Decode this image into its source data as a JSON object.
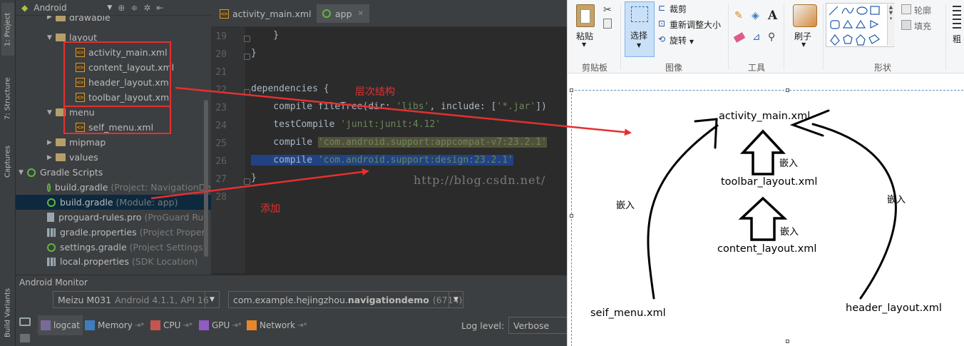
{
  "ide": {
    "tool_tabs": [
      "1: Project",
      "7: Structure",
      "Captures",
      "Build Variants"
    ],
    "project_view": "Android",
    "tree": {
      "drawable": "drawable",
      "layout": "layout",
      "layout_files": [
        "activity_main.xml",
        "content_layout.xml",
        "header_layout.xml",
        "toolbar_layout.xml"
      ],
      "menu": "menu",
      "menu_files": [
        "self_menu.xml"
      ],
      "mipmap": "mipmap",
      "values": "values",
      "gradle_scripts": "Gradle Scripts",
      "gradle_items": [
        {
          "name": "build.gradle",
          "sub": "(Project: NavigationDe"
        },
        {
          "name": "build.gradle",
          "sub": "(Module: app)"
        },
        {
          "name": "proguard-rules.pro",
          "sub": "(ProGuard Rul"
        },
        {
          "name": "gradle.properties",
          "sub": "(Project Propert"
        },
        {
          "name": "settings.gradle",
          "sub": "(Project Settings)"
        },
        {
          "name": "local.properties",
          "sub": "(SDK Location)"
        }
      ]
    },
    "editor_tabs": [
      "activity_main.xml",
      "app"
    ],
    "line_numbers": [
      "19",
      "20",
      "21",
      "22",
      "23",
      "24",
      "25",
      "26",
      "27",
      "28"
    ],
    "code": {
      "l19": "    }",
      "l20": "}",
      "l22": "dependencies {",
      "l23_a": "    compile fileTree(dir: ",
      "l23_s1": "'libs'",
      "l23_b": ", include: [",
      "l23_s2": "'*.jar'",
      "l23_c": "])",
      "l24_a": "    testCompile ",
      "l24_s": "'junit:junit:4.12'",
      "l25_a": "    compile ",
      "l25_s": "'com.android.support:appcompat-v7:23.2.1'",
      "l26_a": "    compile ",
      "l26_s": "'com.android.support:design:23.2.1'",
      "l27": "}"
    },
    "annotation_layers": "层次结构",
    "annotation_add": "添加",
    "watermark": "http://blog.csdn.net/",
    "monitor": {
      "title": "Android Monitor",
      "device": "Meizu M031",
      "device_sub": "Android 4.1.1, API 16",
      "process_prefix": "com.example.hejingzhou.",
      "process_bold": "navigationdemo",
      "process_pid": "(6714)",
      "tabs": [
        "logcat",
        "Memory",
        "CPU",
        "GPU",
        "Network"
      ],
      "log_level_label": "Log level:",
      "log_level_value": "Verbose"
    }
  },
  "paint": {
    "ribbon": {
      "clipboard_label": "剪贴板",
      "paste": "粘贴",
      "select": "选择",
      "crop": "裁剪",
      "resize": "重新调整大小",
      "rotate": "旋转",
      "image_label": "图像",
      "tools_label": "工具",
      "brushes": "刷子",
      "outline": "轮廓",
      "fill": "填充",
      "shapes_label": "形状",
      "thick": "粗"
    },
    "diagram": {
      "activity_main": "activity_main.xml",
      "toolbar_layout": "toolbar_layout.xml",
      "content_layout": "content_layout.xml",
      "seif_menu": "seif_menu.xml",
      "header_layout": "header_layout.xml",
      "embed_1": "嵌入",
      "embed_2": "嵌入",
      "embed_left": "嵌入",
      "embed_right": "嵌入"
    }
  },
  "colors": {
    "annotation_red": "#e53030",
    "ide_bg": "#2b2b2b",
    "panel_bg": "#3c3f41",
    "string_green": "#6a8759",
    "selection_blue": "#214283"
  }
}
